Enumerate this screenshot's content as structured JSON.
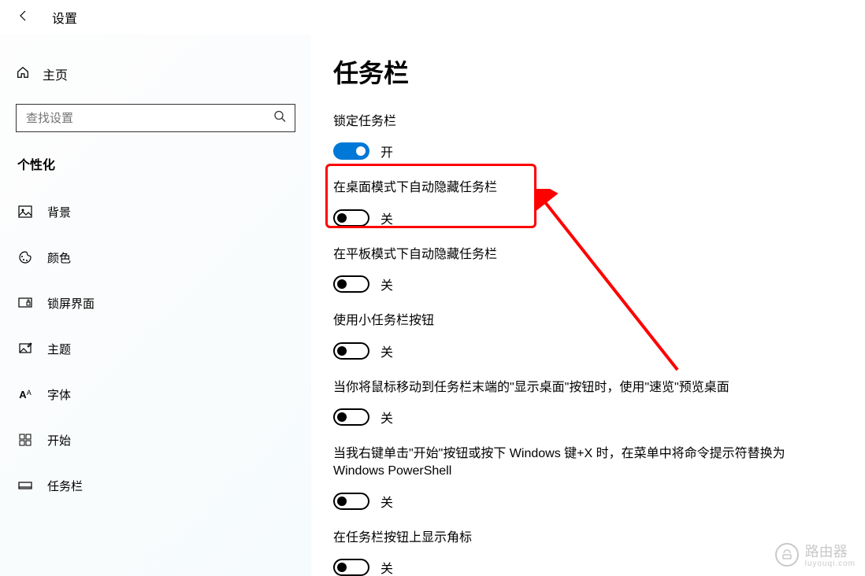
{
  "titlebar": {
    "title": "设置"
  },
  "sidebar": {
    "home": "主页",
    "search_placeholder": "查找设置",
    "category": "个性化",
    "items": [
      {
        "label": "背景"
      },
      {
        "label": "颜色"
      },
      {
        "label": "锁屏界面"
      },
      {
        "label": "主题"
      },
      {
        "label": "字体"
      },
      {
        "label": "开始"
      },
      {
        "label": "任务栏"
      }
    ]
  },
  "content": {
    "heading": "任务栏",
    "on_label": "开",
    "off_label": "关",
    "settings": [
      {
        "label": "锁定任务栏",
        "on": true
      },
      {
        "label": "在桌面模式下自动隐藏任务栏",
        "on": false
      },
      {
        "label": "在平板模式下自动隐藏任务栏",
        "on": false
      },
      {
        "label": "使用小任务栏按钮",
        "on": false
      },
      {
        "label": "当你将鼠标移动到任务栏末端的\"显示桌面\"按钮时，使用\"速览\"预览桌面",
        "on": false
      },
      {
        "label": "当我右键单击\"开始\"按钮或按下 Windows 键+X 时，在菜单中将命令提示符替换为 Windows PowerShell",
        "on": false
      },
      {
        "label": "在任务栏按钮上显示角标",
        "on": false
      }
    ]
  },
  "watermark": {
    "text": "路由器",
    "sub": "luyouqi.com"
  }
}
